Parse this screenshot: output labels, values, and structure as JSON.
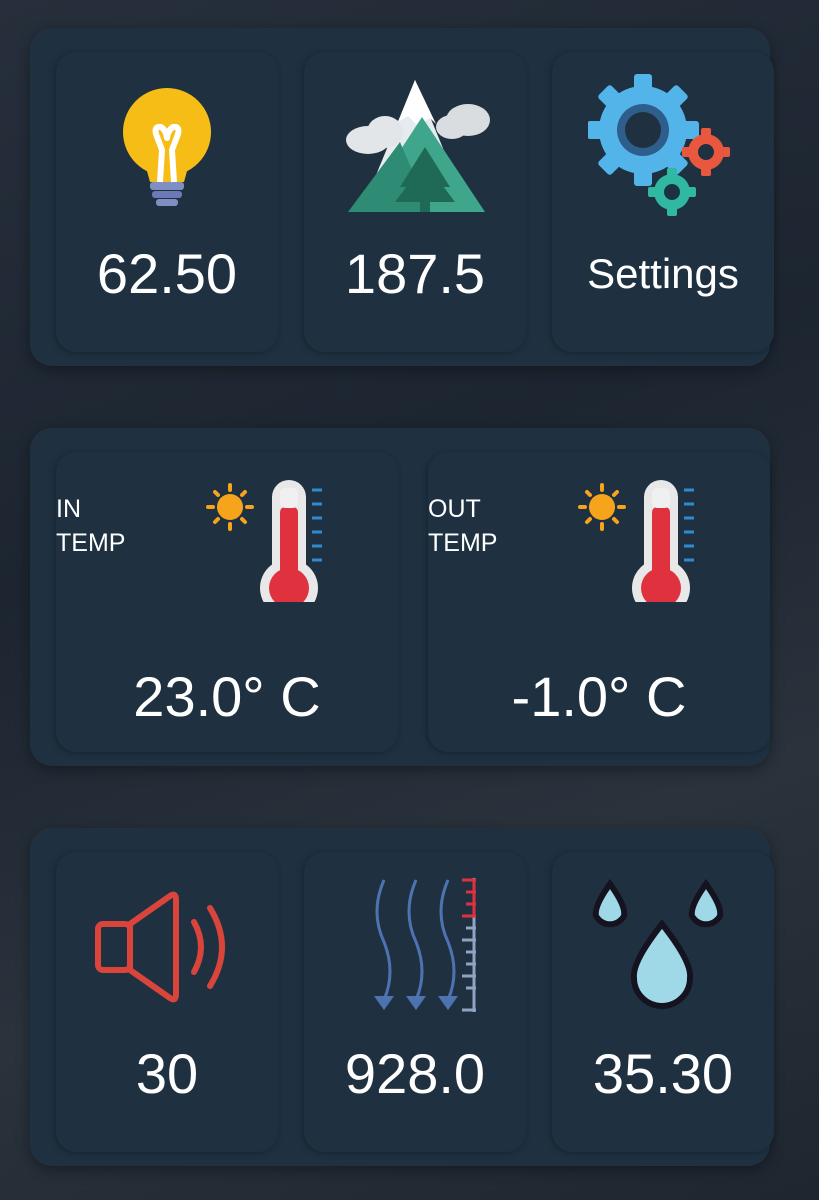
{
  "panel_top": {
    "tiles": [
      {
        "icon": "light-bulb-icon",
        "value": "62.50"
      },
      {
        "icon": "mountain-icon",
        "value": "187.5"
      },
      {
        "icon": "gears-icon",
        "value": "Settings"
      }
    ]
  },
  "panel_temp": {
    "tiles": [
      {
        "label": "IN\nTEMP",
        "icon": "thermometer-sun-icon",
        "value": "23.0° C"
      },
      {
        "label": "OUT\nTEMP",
        "icon": "thermometer-sun-icon",
        "value": "-1.0° C"
      }
    ]
  },
  "panel_bottom": {
    "tiles": [
      {
        "icon": "speaker-icon",
        "value": "30"
      },
      {
        "icon": "pressure-arrows-icon",
        "value": "928.0"
      },
      {
        "icon": "water-drops-icon",
        "value": "35.30"
      }
    ]
  },
  "colors": {
    "background": "#1c2530",
    "panel": "#1f3141",
    "text": "#ffffff",
    "thermometer_red": "#e0313e",
    "speaker_red": "#d9453a",
    "pressure_blue": "#4d74b0",
    "drop_blue": "#9fd8e6"
  }
}
